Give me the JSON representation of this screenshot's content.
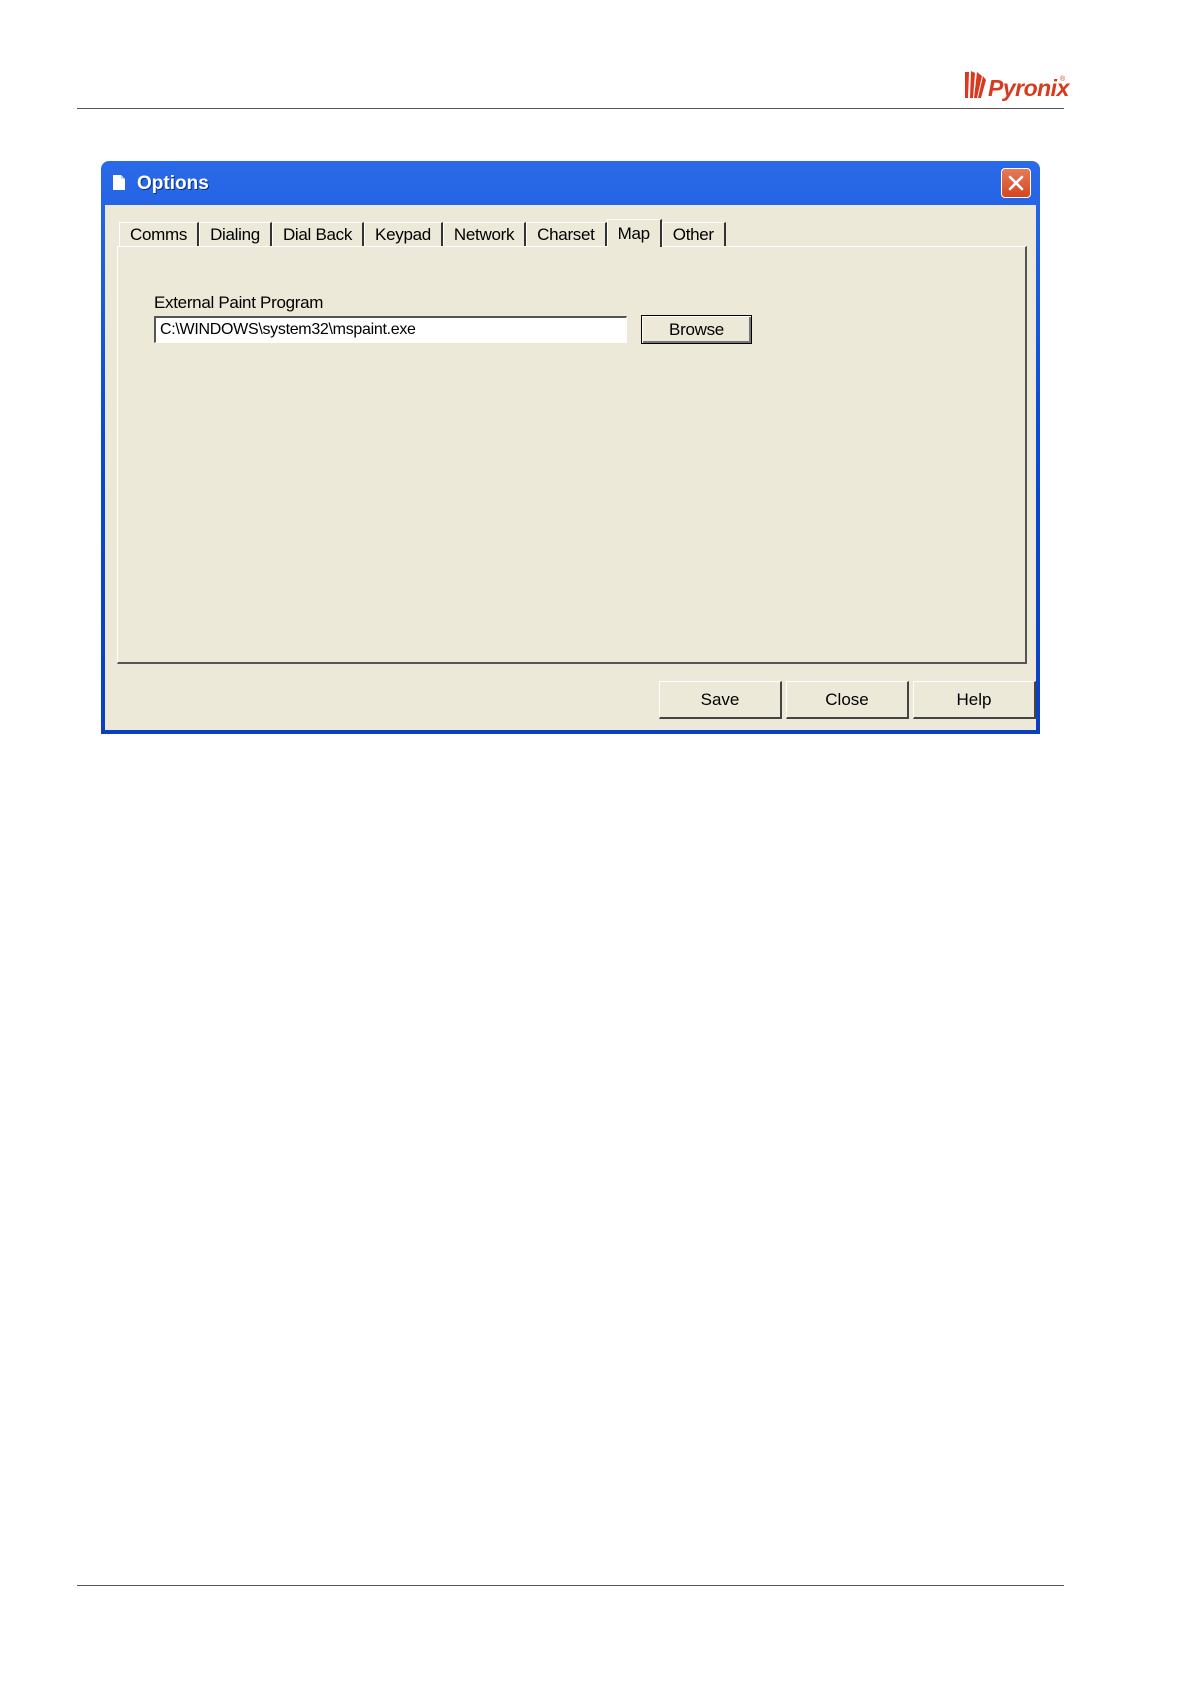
{
  "brand": {
    "logo_text": "Pyronix",
    "logo_mark": "®",
    "colors": {
      "logo": "#d73a1e"
    }
  },
  "window": {
    "title": "Options",
    "icon": "document-icon",
    "colors": {
      "titlebar": "#0a48d6",
      "client": "#ece9d8",
      "close": "#d3461f"
    }
  },
  "tabs": [
    {
      "label": "Comms",
      "active": false
    },
    {
      "label": "Dialing",
      "active": false
    },
    {
      "label": "Dial Back",
      "active": false
    },
    {
      "label": "Keypad",
      "active": false
    },
    {
      "label": "Network",
      "active": false
    },
    {
      "label": "Charset",
      "active": false
    },
    {
      "label": "Map",
      "active": true
    },
    {
      "label": "Other",
      "active": false
    }
  ],
  "map_panel": {
    "label": "External Paint Program",
    "path_value": "C:\\WINDOWS\\system32\\mspaint.exe",
    "browse_label": "Browse"
  },
  "footer_buttons": {
    "save_label": "Save",
    "close_label": "Close",
    "help_label": "Help"
  }
}
